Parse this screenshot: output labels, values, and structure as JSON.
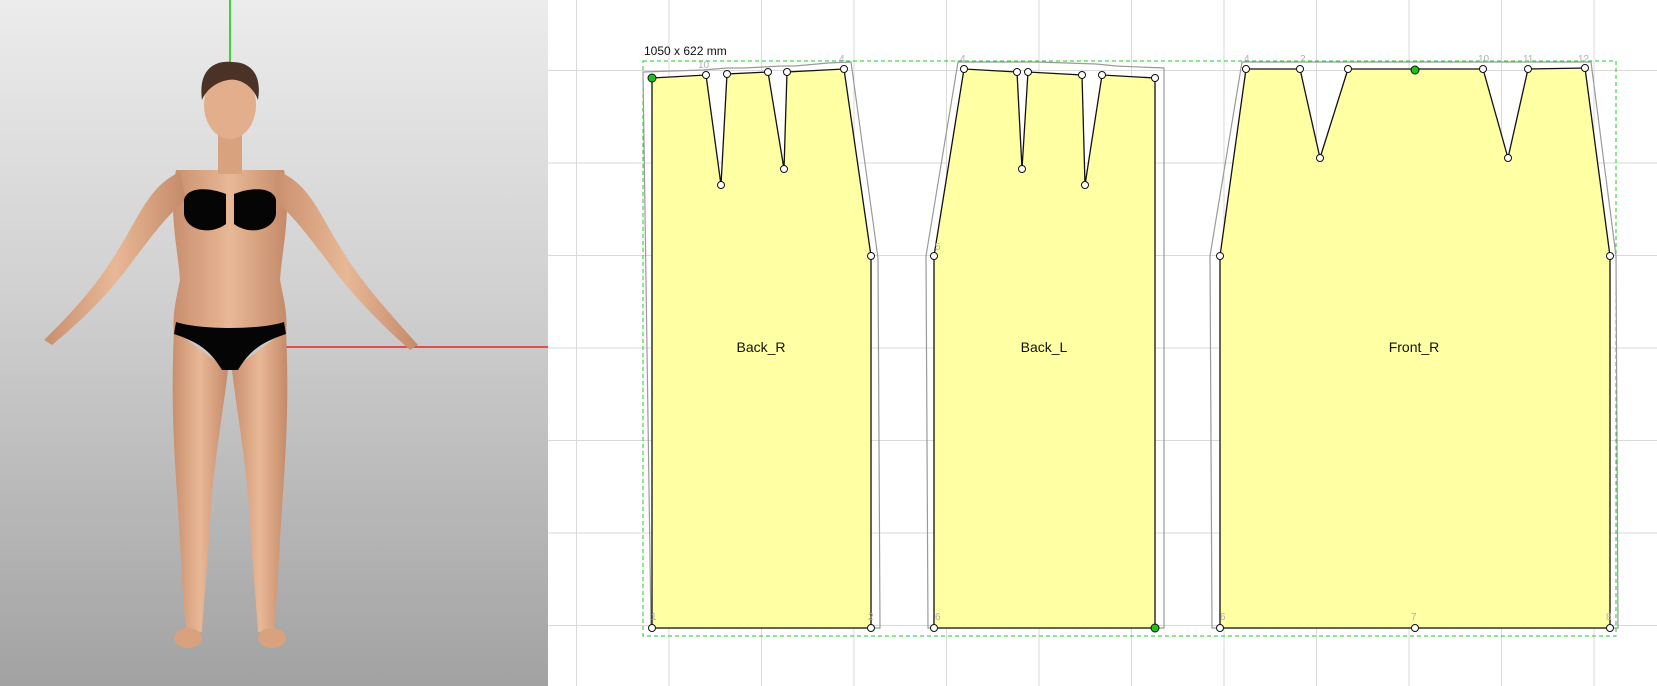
{
  "viewport2d": {
    "layout_size_label": "1050 x 622 mm",
    "pieces": [
      {
        "name": "Back_R"
      },
      {
        "name": "Back_L"
      },
      {
        "name": "Front_R"
      }
    ]
  },
  "colors": {
    "piece_fill": "#ffffa3",
    "piece_outline": "#111111",
    "seam_allowance": "#9a9a9a",
    "bounding_box": "#22cc22",
    "selected_point": "#19c419",
    "axis_y": "#00cc00",
    "axis_x": "#ee2222"
  },
  "icons": {
    "vertex": "circle-vertex-icon"
  }
}
